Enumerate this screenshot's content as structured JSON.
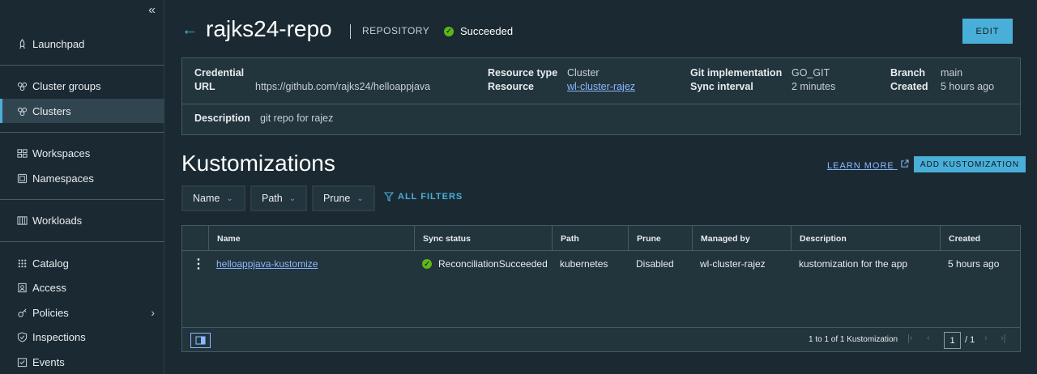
{
  "sidebar": {
    "items": [
      {
        "label": "Launchpad",
        "icon": "rocket-icon"
      },
      {
        "label": "Cluster groups",
        "icon": "cluster-groups-icon"
      },
      {
        "label": "Clusters",
        "icon": "clusters-icon"
      },
      {
        "label": "Workspaces",
        "icon": "workspaces-icon"
      },
      {
        "label": "Namespaces",
        "icon": "namespaces-icon"
      },
      {
        "label": "Workloads",
        "icon": "workloads-icon"
      },
      {
        "label": "Catalog",
        "icon": "catalog-icon"
      },
      {
        "label": "Access",
        "icon": "access-icon"
      },
      {
        "label": "Policies",
        "icon": "policies-icon"
      },
      {
        "label": "Inspections",
        "icon": "inspections-icon"
      },
      {
        "label": "Events",
        "icon": "events-icon"
      }
    ]
  },
  "header": {
    "title": "rajks24-repo",
    "kind": "REPOSITORY",
    "status": "Succeeded",
    "edit_label": "EDIT"
  },
  "details": {
    "credential_label": "Credential",
    "url_label": "URL",
    "url_value": "https://github.com/rajks24/helloappjava",
    "resource_type_label": "Resource type",
    "resource_type_value": "Cluster",
    "resource_label": "Resource",
    "resource_value": "wl-cluster-rajez",
    "git_impl_label": "Git implementation",
    "git_impl_value": "GO_GIT",
    "sync_interval_label": "Sync interval",
    "sync_interval_value": "2 minutes",
    "branch_label": "Branch",
    "branch_value": "main",
    "created_label": "Created",
    "created_value": "5 hours ago",
    "description_label": "Description",
    "description_value": "git repo for rajez"
  },
  "kustomizations": {
    "title": "Kustomizations",
    "learn_more": "LEARN MORE",
    "add_label": "ADD KUSTOMIZATION",
    "filters": [
      "Name",
      "Path",
      "Prune"
    ],
    "all_filters": "ALL FILTERS",
    "columns": [
      "Name",
      "Sync status",
      "Path",
      "Prune",
      "Managed by",
      "Description",
      "Created"
    ],
    "rows": [
      {
        "name": "helloappjava-kustomize",
        "sync_status": "ReconciliationSucceeded",
        "path": "kubernetes",
        "prune": "Disabled",
        "managed_by": "wl-cluster-rajez",
        "description": "kustomization for the app",
        "created": "5 hours ago"
      }
    ],
    "pagination": {
      "summary": "1 to 1 of 1 Kustomization",
      "page": "1",
      "total": "/ 1"
    }
  },
  "colors": {
    "accent": "#49afd9",
    "success": "#5eb715",
    "background": "#1b2a32",
    "link": "#8db8ff"
  }
}
